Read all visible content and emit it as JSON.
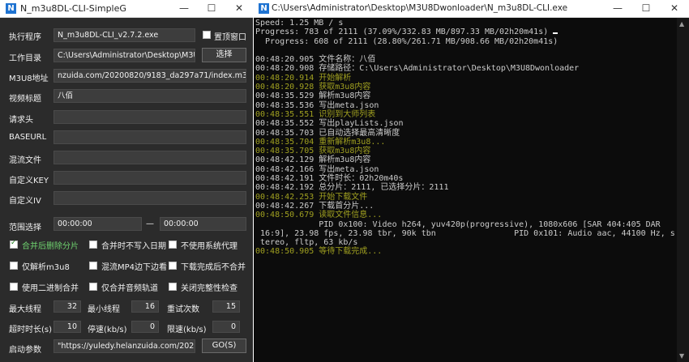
{
  "left": {
    "title": "N_m3u8DL-CLI-SimpleG",
    "icon_letter": "N",
    "controls": {
      "minimize": "—",
      "maximize": "☐",
      "close": "✕"
    },
    "fields": {
      "exec_label": "执行程序",
      "exec_value": "N_m3u8DL-CLI_v2.7.2.exe",
      "topmost_label": "置顶窗口",
      "workdir_label": "工作目录",
      "workdir_value": "C:\\Users\\Administrator\\Desktop\\M3U",
      "browse_button": "选择",
      "url_label": "M3U8地址",
      "url_value": "nzuida.com/20200820/9183_da297a71/index.m3u8",
      "title_label": "视频标题",
      "title_value": "八佰",
      "headers_label": "请求头",
      "baseurl_label": "BASEURL",
      "mux_label": "混流文件",
      "key_label": "自定义KEY",
      "iv_label": "自定义IV",
      "range_label": "范围选择",
      "range_start": "00:00:00",
      "range_sep": "—",
      "range_end": "00:00:00"
    },
    "options": [
      {
        "label": "合并后删除分片",
        "checked": true
      },
      {
        "label": "合并时不写入日期",
        "checked": false
      },
      {
        "label": "不使用系统代理",
        "checked": false
      },
      {
        "label": "仅解析m3u8",
        "checked": false
      },
      {
        "label": "混流MP4边下边看",
        "checked": false
      },
      {
        "label": "下载完成后不合并",
        "checked": false
      },
      {
        "label": "使用二进制合并",
        "checked": false
      },
      {
        "label": "仅合并音频轨道",
        "checked": false
      },
      {
        "label": "关闭完整性检查",
        "checked": false
      }
    ],
    "numbers": {
      "max_threads_label": "最大线程",
      "max_threads": "32",
      "min_threads_label": "最小线程",
      "min_threads": "16",
      "retry_label": "重试次数",
      "retry": "15",
      "timeout_label": "超时时长(s)",
      "timeout": "10",
      "stop_speed_label": "停速(kb/s)",
      "stop_speed": "0",
      "limit_speed_label": "限速(kb/s)",
      "limit_speed": "0"
    },
    "start": {
      "label": "启动参数",
      "value": "\"https://yuledy.helanzuida.com/20200",
      "go_button": "GO(S)"
    }
  },
  "right": {
    "title": "C:\\Users\\Administrator\\Desktop\\M3U8Dwonloader\\N_m3u8DL-CLI.exe",
    "icon_letter": "N",
    "controls": {
      "minimize": "—",
      "maximize": "☐",
      "close": "✕"
    },
    "lines": [
      {
        "text": "Speed: 1.25 MB / s",
        "color": "normal"
      },
      {
        "text": "Progress: 783 of 2111 (37.09%/332.83 MB/897.33 MB/02h20m41s)",
        "color": "normal",
        "cursor": true
      },
      {
        "text": "  Progress: 608 of 2111 (28.80%/261.71 MB/908.66 MB/02h20m41s)",
        "color": "normal"
      },
      {
        "text": "",
        "color": "normal"
      },
      {
        "text": "00:48:20.905 文件名称：八佰",
        "color": "normal"
      },
      {
        "text": "00:48:20.908 存储路径：C:\\Users\\Administrator\\Desktop\\M3U8Dwonloader",
        "color": "normal"
      },
      {
        "text": "00:48:20.914 开始解析",
        "color": "yellow"
      },
      {
        "text": "00:48:20.928 获取m3u8内容",
        "color": "yellow"
      },
      {
        "text": "00:48:35.529 解析m3u8内容",
        "color": "normal"
      },
      {
        "text": "00:48:35.536 写出meta.json",
        "color": "normal"
      },
      {
        "text": "00:48:35.551 识别到大师列表",
        "color": "yellow"
      },
      {
        "text": "00:48:35.552 写出playLists.json",
        "color": "normal"
      },
      {
        "text": "00:48:35.703 已自动选择最高清晰度",
        "color": "normal"
      },
      {
        "text": "00:48:35.704 重新解析m3u8...",
        "color": "yellow"
      },
      {
        "text": "00:48:35.705 获取m3u8内容",
        "color": "yellow"
      },
      {
        "text": "00:48:42.129 解析m3u8内容",
        "color": "normal"
      },
      {
        "text": "00:48:42.166 写出meta.json",
        "color": "normal"
      },
      {
        "text": "00:48:42.191 文件时长：02h20m40s",
        "color": "normal"
      },
      {
        "text": "00:48:42.192 总分片：2111, 已选择分片：2111",
        "color": "normal"
      },
      {
        "text": "00:48:42.253 开始下载文件",
        "color": "yellow"
      },
      {
        "text": "00:48:42.267 下载首分片...",
        "color": "normal"
      },
      {
        "text": "00:48:50.679 读取文件信息...",
        "color": "yellow"
      },
      {
        "text": "             PID 0x100: Video h264, yuv420p(progressive), 1080x606 [SAR 404:405 DAR",
        "color": "normal"
      },
      {
        "text": " 16:9], 23.98 fps, 23.98 tbr, 90k tbn                PID 0x101: Audio aac, 44100 Hz, s",
        "color": "normal"
      },
      {
        "text": " tereo, fltp, 63 kb/s",
        "color": "normal"
      },
      {
        "text": "00:48:50.905 等待下载完成...",
        "color": "yellow"
      }
    ],
    "scroll_up": "▲",
    "scroll_down": "▼"
  }
}
